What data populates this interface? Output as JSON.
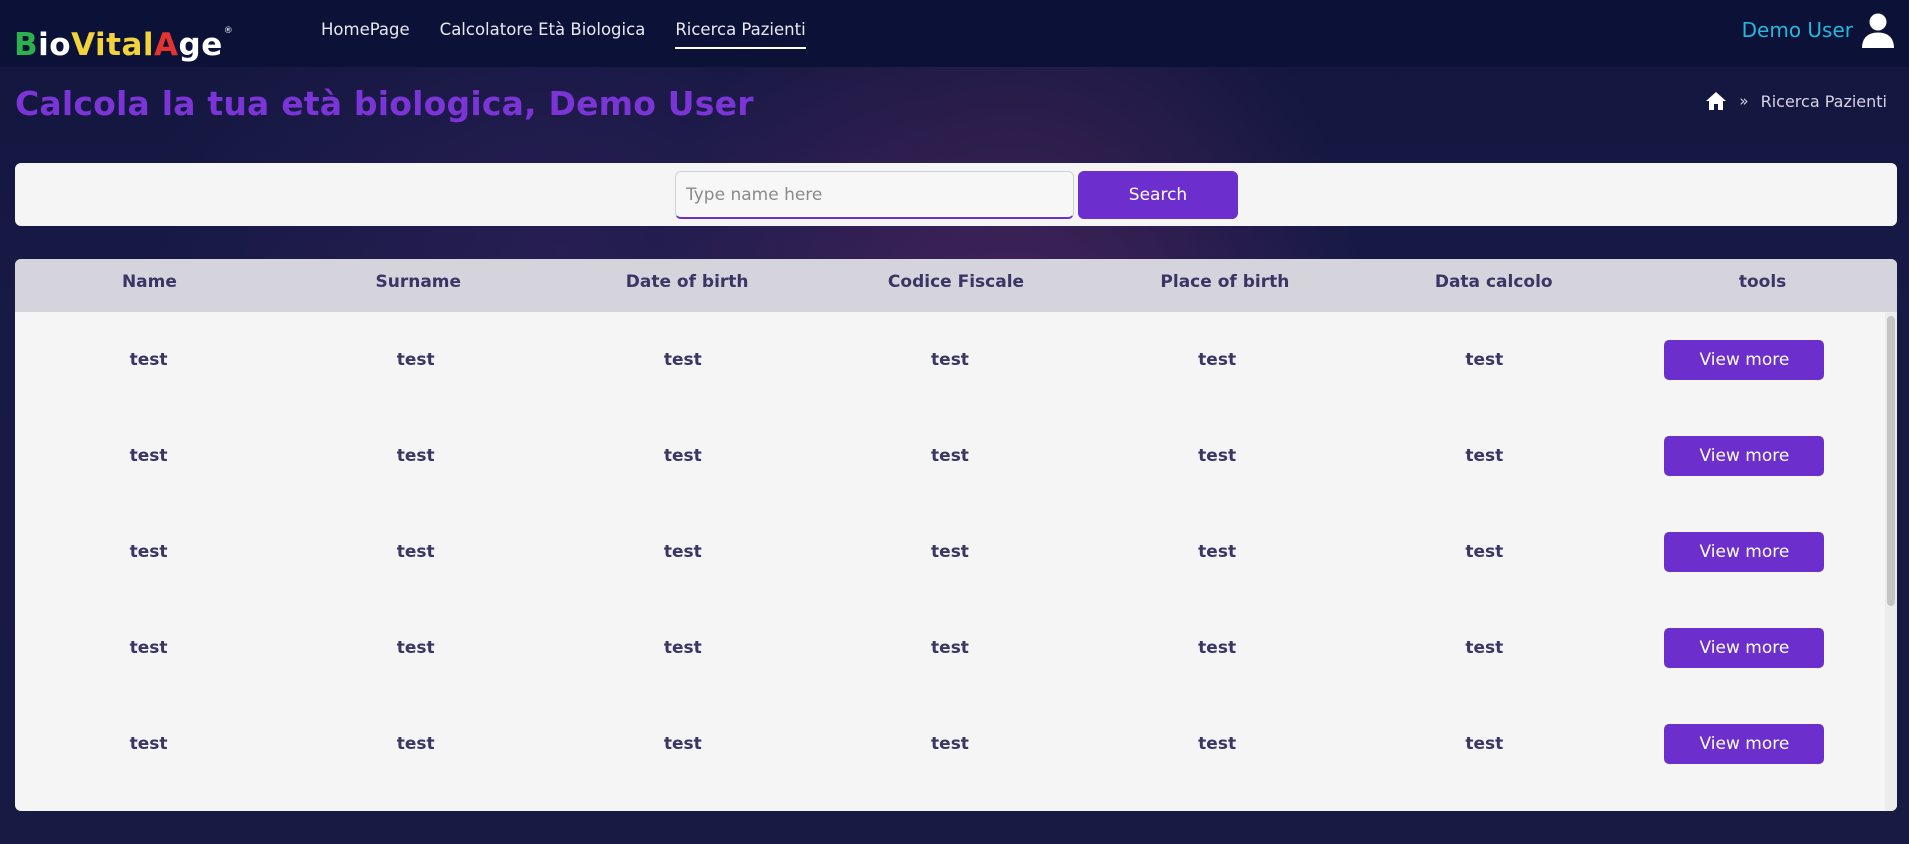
{
  "navbar": {
    "logo": {
      "part1": "B",
      "part2": "io",
      "part3": "Vital",
      "part4": "A",
      "part5": "ge",
      "mark": "®"
    },
    "links": [
      {
        "label": "HomePage"
      },
      {
        "label": "Calcolatore Età Biologica"
      },
      {
        "label": "Ricerca Pazienti"
      }
    ],
    "active_link": "Ricerca Pazienti",
    "user_name": "Demo User"
  },
  "header": {
    "title": "Calcola la tua età biologica, Demo User",
    "breadcrumb": {
      "separator": "»",
      "current": "Ricerca Pazienti"
    }
  },
  "search": {
    "placeholder": "Type name here",
    "value": "",
    "button_label": "Search"
  },
  "table": {
    "columns": [
      "Name",
      "Surname",
      "Date of birth",
      "Codice Fiscale",
      "Place of birth",
      "Data calcolo",
      "tools"
    ],
    "rows": [
      {
        "name": "test",
        "surname": "test",
        "dob": "test",
        "cf": "test",
        "pob": "test",
        "data_calcolo": "test",
        "action": "View more"
      },
      {
        "name": "test",
        "surname": "test",
        "dob": "test",
        "cf": "test",
        "pob": "test",
        "data_calcolo": "test",
        "action": "View more"
      },
      {
        "name": "test",
        "surname": "test",
        "dob": "test",
        "cf": "test",
        "pob": "test",
        "data_calcolo": "test",
        "action": "View more"
      },
      {
        "name": "test",
        "surname": "test",
        "dob": "test",
        "cf": "test",
        "pob": "test",
        "data_calcolo": "test",
        "action": "View more"
      },
      {
        "name": "test",
        "surname": "test",
        "dob": "test",
        "cf": "test",
        "pob": "test",
        "data_calcolo": "test",
        "action": "View more"
      }
    ]
  },
  "colors": {
    "accent": "#6c2fce",
    "title": "#7b34d6",
    "user_name": "#27b5dc",
    "navbar_bg": "#0c1237"
  },
  "icons": {
    "user": "user-icon",
    "home": "home-icon"
  }
}
